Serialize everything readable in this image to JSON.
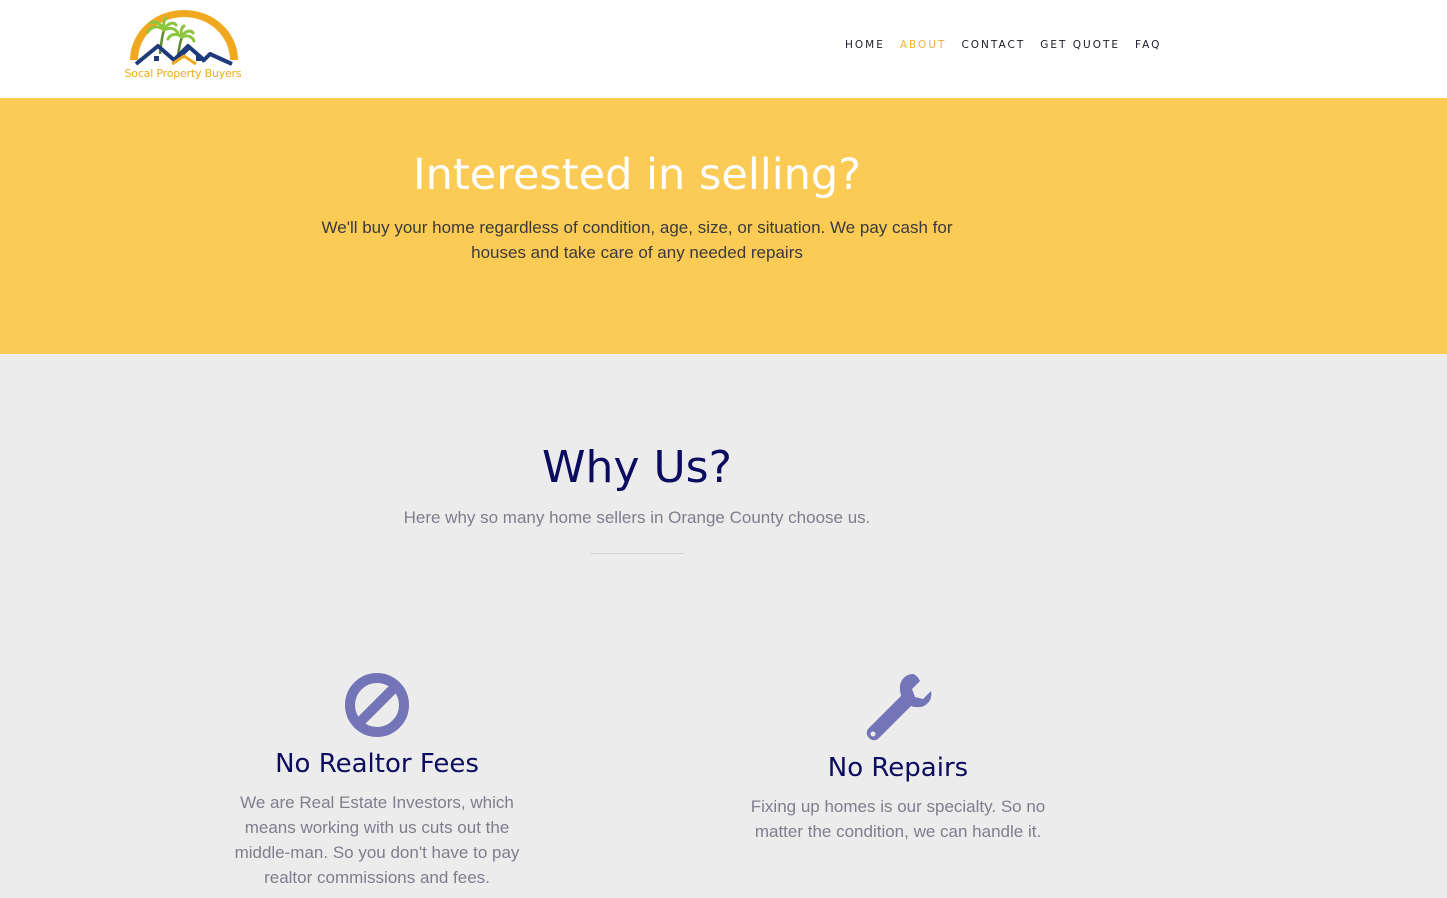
{
  "header": {
    "logo_text": "Socal Property Buyers",
    "nav": [
      {
        "label": "HOME"
      },
      {
        "label": "ABOUT"
      },
      {
        "label": "CONTACT"
      },
      {
        "label": "GET QUOTE"
      },
      {
        "label": "FAQ"
      }
    ],
    "active_nav": "ABOUT"
  },
  "hero": {
    "title": "Interested in selling?",
    "subtitle": "We'll buy your home regardless of condition, age, size, or situation. We pay cash for houses and take care of any needed repairs"
  },
  "why": {
    "title": "Why Us?",
    "subtitle": "Here why so many home sellers in Orange County choose us.",
    "features": [
      {
        "icon": "ban-icon",
        "title": "No Realtor Fees",
        "text": "We are Real Estate Investors, which means working with us cuts out the middle-man. So you don't have to pay realtor commissions and fees."
      },
      {
        "icon": "wrench-icon",
        "title": "No Repairs",
        "text": "Fixing up homes is our specialty. So no matter the condition, we can handle it."
      }
    ]
  },
  "colors": {
    "hero_bg": "#fbcb56",
    "accent": "#f2b13c",
    "heading": "#0b0b5f",
    "icon": "#7474b8",
    "body_text": "#7e7e8c",
    "section_bg": "#ececec"
  }
}
